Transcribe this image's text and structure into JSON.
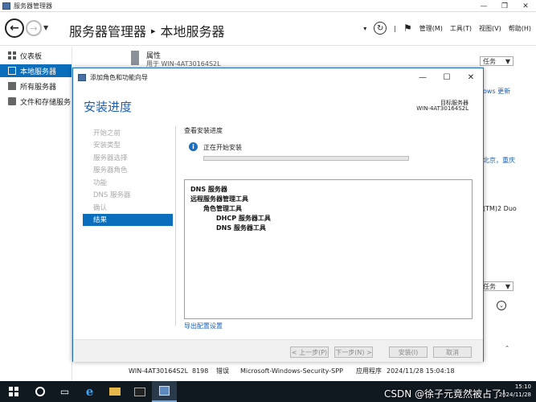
{
  "server_manager": {
    "title": "服务器管理器",
    "breadcrumb_root": "服务器管理器",
    "breadcrumb_sep": "▸",
    "breadcrumb_current": "本地服务器",
    "menus": [
      "管理(M)",
      "工具(T)",
      "视图(V)",
      "帮助(H)"
    ],
    "sidebar": [
      {
        "label": "仪表板",
        "icon": "dashboard-icon"
      },
      {
        "label": "本地服务器",
        "icon": "local-server-icon",
        "active": true
      },
      {
        "label": "所有服务器",
        "icon": "all-servers-icon"
      },
      {
        "label": "文件和存储服务",
        "icon": "file-storage-icon"
      }
    ],
    "properties_title": "属性",
    "properties_sub": "用于 WIN-4AT30164S2L",
    "tasks_label": "任务",
    "bg_fragments": [
      "ows 更新",
      "北京，重庆",
      "(TM)2 Duo"
    ],
    "event_row": {
      "server": "WIN-4AT30164S2L",
      "id": "8198",
      "level": "错误",
      "source": "Microsoft-Windows-Security-SPP",
      "log": "应用程序",
      "time": "2024/11/28 15:04:18"
    }
  },
  "wizard": {
    "title": "添加角色和功能向导",
    "heading": "安装进度",
    "target_label": "目标服务器",
    "target_name": "WIN-4AT30164S2L",
    "steps": [
      {
        "label": "开始之前",
        "active": false
      },
      {
        "label": "安装类型",
        "active": false
      },
      {
        "label": "服务器选择",
        "active": false
      },
      {
        "label": "服务器角色",
        "active": false
      },
      {
        "label": "功能",
        "active": false
      },
      {
        "label": "DNS 服务器",
        "active": false
      },
      {
        "label": "确认",
        "active": false
      },
      {
        "label": "结果",
        "active": true
      }
    ],
    "view_label": "查看安装进度",
    "status": "正在开始安装",
    "progress": 0,
    "results": [
      {
        "label": "DNS 服务器",
        "level": 1
      },
      {
        "label": "远程服务器管理工具",
        "level": 1
      },
      {
        "label": "角色管理工具",
        "level": 2
      },
      {
        "label": "DHCP 服务器工具",
        "level": 3
      },
      {
        "label": "DNS 服务器工具",
        "level": 3
      }
    ],
    "export_link": "导出配置设置",
    "buttons": {
      "prev": "< 上一步(P)",
      "next": "下一步(N) >",
      "install": "安装(I)",
      "cancel": "取消"
    }
  },
  "taskbar": {
    "time": "15:10",
    "date": "2024/11/28"
  },
  "watermark": "CSDN @徐子元竟然被占了！"
}
